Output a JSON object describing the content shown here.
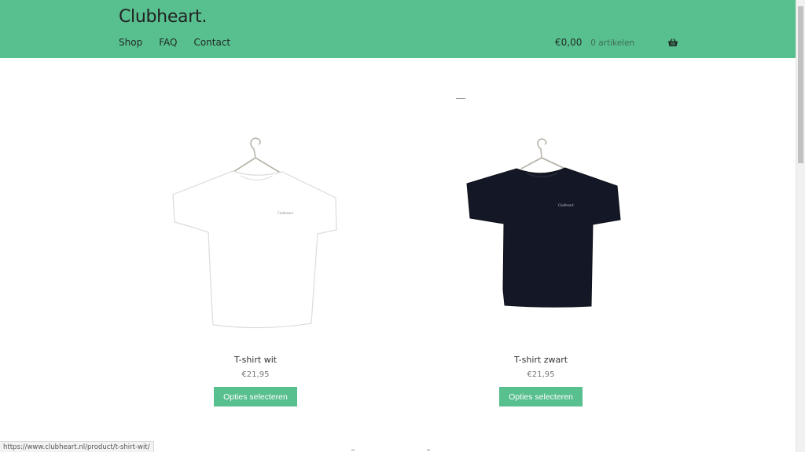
{
  "header": {
    "logo": "Clubheart.",
    "nav": [
      "Shop",
      "FAQ",
      "Contact"
    ],
    "cart_total": "€0,00",
    "cart_count": "0 artikelen",
    "background": "#58bf8f"
  },
  "products": [
    {
      "title": "T-shirt wit",
      "price": "€21,95",
      "button": "Opties selecteren",
      "shirt_color": "#ffffff",
      "print": "Clubheart."
    },
    {
      "title": "T-shirt zwart",
      "price": "€21,95",
      "button": "Opties selecteren",
      "shirt_color": "#141826",
      "print": "Clubheart."
    }
  ],
  "status_bar": {
    "url": "https://www.clubheart.nl/product/t-shirt-wit/"
  },
  "accent_color": "#58bf8f"
}
